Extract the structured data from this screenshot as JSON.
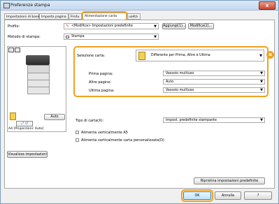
{
  "window": {
    "title": "Preferenze stampa",
    "close_glyph": "x"
  },
  "tabs": [
    "Impostazioni di base",
    "Imposta pagina",
    "Finitu",
    "Alimentazione carta",
    "ualità"
  ],
  "profile": {
    "label": "Profilo:",
    "value": "<Modifica> Impostazioni predefinite",
    "add_button": "Aggiungi(1)...",
    "edit_button": "Modifica(2)..."
  },
  "output_method": {
    "label": "Metodo di stampa:",
    "value": "Stampa"
  },
  "preview": {
    "paper_label": "A4 [Proporzioni: Auto]",
    "auto_button": "Auto",
    "view_settings_button": "Visualizza impostazioni"
  },
  "paper_selection": {
    "label": "Selezione carta:",
    "value": "Differente per Prima, Altre e Ultima",
    "badge": "a",
    "rows": [
      {
        "label": "Prima pagina:",
        "value": "Vassoio multiuso"
      },
      {
        "label": "Altre pagine:",
        "value": "Auto"
      },
      {
        "label": "Ultima pagina:",
        "value": "Vassoio multiuso"
      }
    ]
  },
  "paper_type": {
    "label": "Tipo di carta(X):",
    "value": "Impost. predefinite stampante"
  },
  "checkboxes": [
    "Alimenta verticalmente A5",
    "Alimenta verticalmente carta personalizzata(D)"
  ],
  "restore_button": "Ripristina impostazioni predefinite",
  "footer": {
    "ok": "OK",
    "cancel": "Annulla",
    "help": "?"
  },
  "colors": {
    "accent": "#f0a21f",
    "title_bar": "#c6d9f0"
  },
  "icons": [
    "printer-icon",
    "paper-stack-icon",
    "pencil-icon",
    "print-icon"
  ]
}
